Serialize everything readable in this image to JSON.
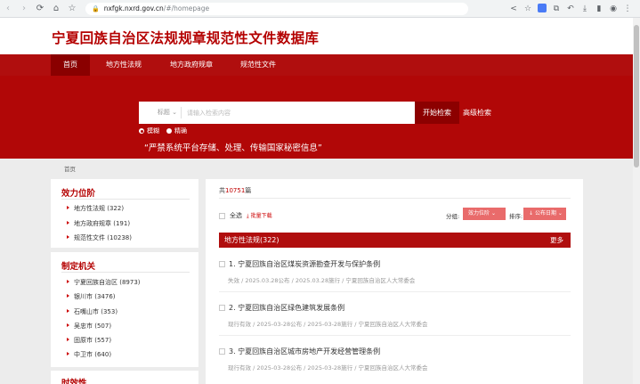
{
  "browser": {
    "url_host": "nxfgk.nxrd.gov.cn",
    "url_path": "/#/homepage"
  },
  "header": {
    "title": "宁夏回族自治区法规规章规范性文件数据库"
  },
  "nav": {
    "items": [
      {
        "label": "首页"
      },
      {
        "label": "地方性法规"
      },
      {
        "label": "地方政府规章"
      },
      {
        "label": "规范性文件"
      }
    ]
  },
  "search": {
    "field_label": "标题",
    "placeholder": "请输入检索内容",
    "button_label": "开始检索",
    "advanced_label": "高级检索",
    "match_fuzzy": "模糊",
    "match_exact": "精确",
    "notice": "“严禁系统平台存储、处理、传输国家秘密信息”"
  },
  "breadcrumb": "首页",
  "sidebar": {
    "effect": {
      "title": "效力位阶",
      "items": [
        "地方性法规 (322)",
        "地方政府规章 (191)",
        "规范性文件 (10238)"
      ]
    },
    "authority": {
      "title": "制定机关",
      "items": [
        "宁夏回族自治区 (8973)",
        "银川市 (3476)",
        "石嘴山市 (353)",
        "吴忠市 (507)",
        "固原市 (557)",
        "中卫市 (640)"
      ]
    },
    "timeliness": {
      "title": "时效性"
    }
  },
  "results": {
    "total_prefix": "共",
    "total_count": "10751",
    "total_suffix": "篇",
    "select_all": "全选",
    "batch_download": "批量下载",
    "group_label": "分组:",
    "group_value": "效力位阶",
    "sort_label": "排序:",
    "sort_value": "公布日期",
    "section_title": "地方性法规(322)",
    "section_more": "更多",
    "items": [
      {
        "title": "1. 宁夏回族自治区煤炭资源勘查开发与保护条例",
        "meta": "失效 / 2025.03.28公布 / 2025.03.28施行 / 宁夏回族自治区人大常委会"
      },
      {
        "title": "2. 宁夏回族自治区绿色建筑发展条例",
        "meta": "现行有效 / 2025-03-28公布 / 2025-03-28施行 / 宁夏回族自治区人大常委会"
      },
      {
        "title": "3. 宁夏回族自治区城市房地产开发经营管理条例",
        "meta": "现行有效 / 2025-03-28公布 / 2025-03-28施行 / 宁夏回族自治区人大常委会"
      }
    ]
  }
}
